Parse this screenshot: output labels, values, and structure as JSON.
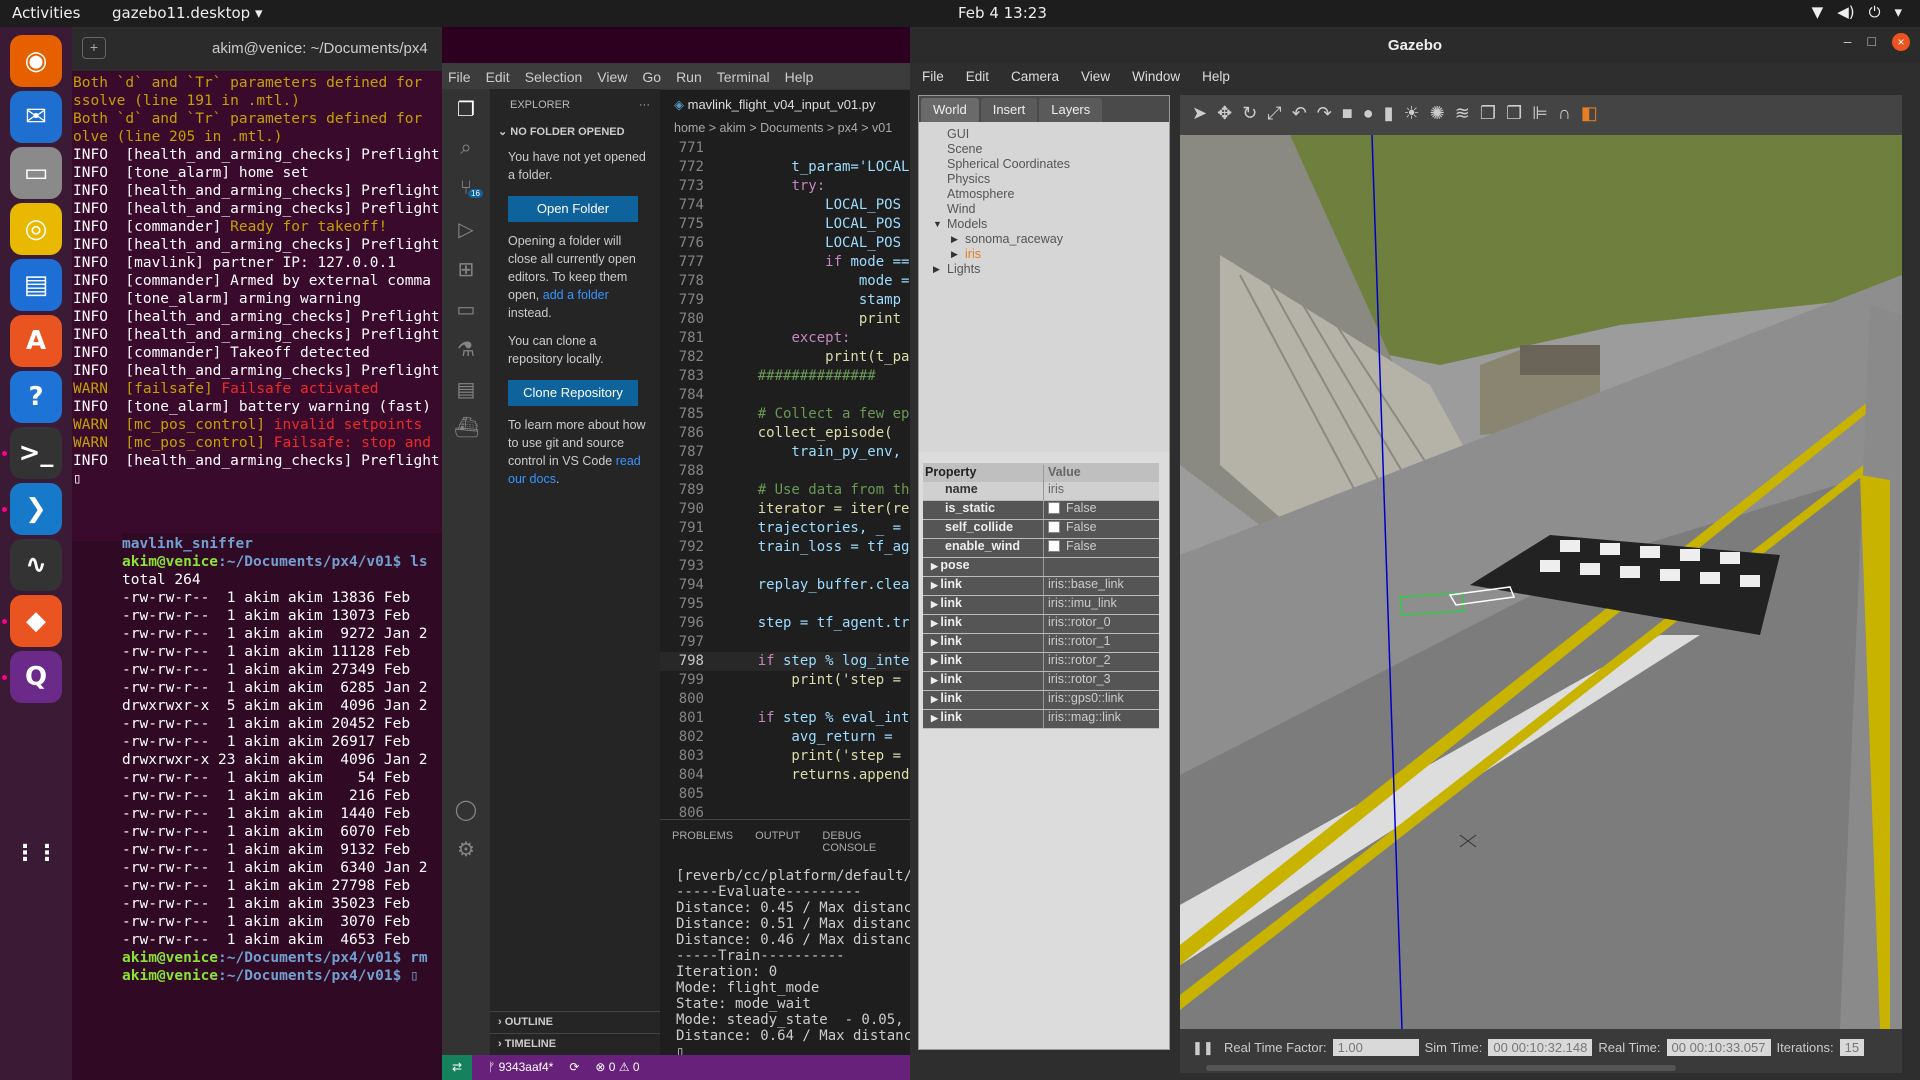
{
  "topbar": {
    "activities": "Activities",
    "app": "gazebo11.desktop ▾",
    "clock": "Feb 4  13:23",
    "tray": [
      "▼",
      "◀)",
      "⏻",
      "▾"
    ]
  },
  "dock": [
    {
      "icon": "firefox-icon",
      "glyph": "◉",
      "color": "#e66000"
    },
    {
      "icon": "thunderbird-icon",
      "glyph": "✉",
      "color": "#1f6fd0"
    },
    {
      "icon": "files-icon",
      "glyph": "▭",
      "color": "#8a8a8a"
    },
    {
      "icon": "rhythmbox-icon",
      "glyph": "◎",
      "color": "#e8b900"
    },
    {
      "icon": "writer-icon",
      "glyph": "▤",
      "color": "#1d6fd6"
    },
    {
      "icon": "software-icon",
      "glyph": "A",
      "color": "#e95420"
    },
    {
      "icon": "help-icon",
      "glyph": "?",
      "color": "#1d73d6"
    },
    {
      "icon": "terminal-icon",
      "glyph": ">_",
      "color": "#333"
    },
    {
      "icon": "vscode-icon",
      "glyph": "❯",
      "color": "#1679c9"
    },
    {
      "icon": "monitor-icon",
      "glyph": "∿",
      "color": "#333"
    },
    {
      "icon": "gazebo-icon",
      "glyph": "◆",
      "color": "#e95420"
    },
    {
      "icon": "qgroundcontrol-icon",
      "glyph": "Q",
      "color": "#6b2a8a"
    },
    {
      "icon": "apps-grid-icon",
      "glyph": "⋮⋮",
      "color": "transparent"
    }
  ],
  "terminal": {
    "title": "akim@venice: ~/Documents/px4",
    "pane1": [
      {
        "c": "y",
        "t": "Both `d` and `Tr` parameters defined for"
      },
      {
        "c": "y",
        "t": "ssolve (line 191 in .mtl.)"
      },
      {
        "c": "y",
        "t": "Both `d` and `Tr` parameters defined for"
      },
      {
        "c": "y",
        "t": "olve (line 205 in .mtl.)"
      },
      {
        "c": "",
        "t": ""
      },
      {
        "c": "",
        "t": "INFO  [health_and_arming_checks] Preflight"
      },
      {
        "c": "",
        "t": "INFO  [tone_alarm] home set"
      },
      {
        "c": "",
        "t": "INFO  [health_and_arming_checks] Preflight"
      },
      {
        "c": "",
        "t": "INFO  [health_and_arming_checks] Preflight"
      },
      {
        "c": "",
        "t": "INFO  [commander] ",
        "h": "Ready for takeoff!",
        "hc": "o"
      },
      {
        "c": "",
        "t": "INFO  [health_and_arming_checks] Preflight"
      },
      {
        "c": "",
        "t": "INFO  [mavlink] partner IP: 127.0.0.1"
      },
      {
        "c": "",
        "t": "INFO  [commander] Armed by external comma"
      },
      {
        "c": "",
        "t": "INFO  [tone_alarm] arming warning"
      },
      {
        "c": "",
        "t": "INFO  [health_and_arming_checks] Preflight"
      },
      {
        "c": "",
        "t": "INFO  [health_and_arming_checks] Preflight"
      },
      {
        "c": "",
        "t": "INFO  [commander] Takeoff detected"
      },
      {
        "c": "",
        "t": "INFO  [health_and_arming_checks] Preflight"
      },
      {
        "c": "y",
        "t": "WARN  [failsafe] ",
        "h": "Failsafe activated",
        "hc": "r"
      },
      {
        "c": "",
        "t": "INFO  [tone_alarm] battery warning (fast)"
      },
      {
        "c": "y",
        "t": "WARN  [mc_pos_control] ",
        "h": "invalid setpoints",
        "hc": "r"
      },
      {
        "c": "y",
        "t": "WARN  [mc_pos_control] ",
        "h": "Failsafe: stop and",
        "hc": "r"
      },
      {
        "c": "",
        "t": "INFO  [health_and_arming_checks] Preflight"
      },
      {
        "c": "",
        "t": "▯"
      }
    ],
    "pane2": [
      {
        "c": "b",
        "t": "mavlink_sniffer                      px"
      },
      {
        "c": "g",
        "t": "akim@venice",
        "p": ":~/Documents/px4/v01$ ls"
      },
      {
        "c": "",
        "t": "total 264"
      },
      {
        "c": "",
        "t": "-rw-rw-r--  1 akim akim 13836 Feb"
      },
      {
        "c": "",
        "t": "-rw-rw-r--  1 akim akim 13073 Feb"
      },
      {
        "c": "",
        "t": "-rw-rw-r--  1 akim akim  9272 Jan 2"
      },
      {
        "c": "",
        "t": "-rw-rw-r--  1 akim akim 11128 Feb"
      },
      {
        "c": "",
        "t": "-rw-rw-r--  1 akim akim 27349 Feb"
      },
      {
        "c": "",
        "t": "-rw-rw-r--  1 akim akim  6285 Jan 2"
      },
      {
        "c": "",
        "t": "drwxrwxr-x  5 akim akim  4096 Jan 2"
      },
      {
        "c": "",
        "t": "-rw-rw-r--  1 akim akim 20452 Feb"
      },
      {
        "c": "",
        "t": "-rw-rw-r--  1 akim akim 26917 Feb"
      },
      {
        "c": "",
        "t": "drwxrwxr-x 23 akim akim  4096 Jan 2"
      },
      {
        "c": "",
        "t": "-rw-rw-r--  1 akim akim    54 Feb"
      },
      {
        "c": "",
        "t": "-rw-rw-r--  1 akim akim   216 Feb"
      },
      {
        "c": "",
        "t": "-rw-rw-r--  1 akim akim  1440 Feb"
      },
      {
        "c": "",
        "t": "-rw-rw-r--  1 akim akim  6070 Feb"
      },
      {
        "c": "",
        "t": "-rw-rw-r--  1 akim akim  9132 Feb"
      },
      {
        "c": "",
        "t": "-rw-rw-r--  1 akim akim  6340 Jan 2"
      },
      {
        "c": "",
        "t": "-rw-rw-r--  1 akim akim 27798 Feb"
      },
      {
        "c": "",
        "t": "-rw-rw-r--  1 akim akim 35023 Feb"
      },
      {
        "c": "",
        "t": "-rw-rw-r--  1 akim akim  3070 Feb"
      },
      {
        "c": "",
        "t": "-rw-rw-r--  1 akim akim  4653 Feb"
      },
      {
        "c": "g",
        "t": "akim@venice",
        "p": ":~/Documents/px4/v01$ rm"
      },
      {
        "c": "g",
        "t": "akim@venice",
        "p": ":~/Documents/px4/v01$ ▯"
      }
    ]
  },
  "vscode": {
    "menu": [
      "File",
      "Edit",
      "Selection",
      "View",
      "Go",
      "Run",
      "Terminal",
      "Help"
    ],
    "explorer": {
      "title": "EXPLORER",
      "dots": "···",
      "no_folder": "NO FOLDER OPENED",
      "p1": "You have not yet opened a folder.",
      "open_btn": "Open Folder",
      "p2a": "Opening a folder will close all currently open editors. To keep them open, ",
      "p2link": "add a folder",
      "p2b": " instead.",
      "p3": "You can clone a repository locally.",
      "clone_btn": "Clone Repository",
      "p4a": "To learn more about how to use git and source control in VS Code ",
      "p4link": "read our docs",
      "p4b": ".",
      "outline": "OUTLINE",
      "timeline": "TIMELINE"
    },
    "scm_badge": "16",
    "tab": "mavlink_flight_v04_input_v01.py",
    "breadcrumb": "home > akim > Documents > px4 > v01",
    "code": [
      {
        "n": "771",
        "t": ""
      },
      {
        "n": "772",
        "t": "        t_param='LOCAL"
      },
      {
        "n": "773",
        "t": "        try:"
      },
      {
        "n": "774",
        "t": "            LOCAL_POS"
      },
      {
        "n": "775",
        "t": "            LOCAL_POS"
      },
      {
        "n": "776",
        "t": "            LOCAL_POS"
      },
      {
        "n": "777",
        "t": "            if mode =="
      },
      {
        "n": "778",
        "t": "                mode ="
      },
      {
        "n": "779",
        "t": "                stamp"
      },
      {
        "n": "780",
        "t": "                print"
      },
      {
        "n": "781",
        "t": "        except:"
      },
      {
        "n": "782",
        "t": "            print(t_pa"
      },
      {
        "n": "783",
        "t": "    ##############"
      },
      {
        "n": "784",
        "t": ""
      },
      {
        "n": "785",
        "t": "    # Collect a few ep"
      },
      {
        "n": "786",
        "t": "    collect_episode("
      },
      {
        "n": "787",
        "t": "        train_py_env,"
      },
      {
        "n": "788",
        "t": ""
      },
      {
        "n": "789",
        "t": "    # Use data from th"
      },
      {
        "n": "790",
        "t": "    iterator = iter(re"
      },
      {
        "n": "791",
        "t": "    trajectories, _ ="
      },
      {
        "n": "792",
        "t": "    train_loss = tf_ag"
      },
      {
        "n": "793",
        "t": ""
      },
      {
        "n": "794",
        "t": "    replay_buffer.clea"
      },
      {
        "n": "795",
        "t": ""
      },
      {
        "n": "796",
        "t": "    step = tf_agent.tr"
      },
      {
        "n": "797",
        "t": ""
      },
      {
        "n": "798",
        "t": "    if step % log_inte"
      },
      {
        "n": "799",
        "t": "        print('step ="
      },
      {
        "n": "800",
        "t": ""
      },
      {
        "n": "801",
        "t": "    if step % eval_int"
      },
      {
        "n": "802",
        "t": "        avg_return ="
      },
      {
        "n": "803",
        "t": "        print('step ="
      },
      {
        "n": "804",
        "t": "        returns.append"
      },
      {
        "n": "805",
        "t": ""
      },
      {
        "n": "806",
        "t": ""
      }
    ],
    "panel_tabs": [
      "PROBLEMS",
      "OUTPUT",
      "DEBUG CONSOLE"
    ],
    "panel_out": [
      "[reverb/cc/platform/default/s",
      "-----Evaluate---------",
      "Distance: 0.45 / Max distance",
      "Distance: 0.51 / Max distance",
      "Distance: 0.46 / Max distance",
      "-----Train----------",
      "Iteration: 0",
      "Mode: flight_mode",
      "State: mode_wait",
      "Mode: steady_state  - 0.05, 0",
      "Distance: 0.64 / Max distance",
      "▯"
    ],
    "status": {
      "remote": "⇄",
      "branch": "ᚠ 9343aaf4*",
      "sync": "⟳",
      "problems": "⊗ 0 ⚠ 0"
    }
  },
  "gazebo": {
    "title": "Gazebo",
    "menu": [
      "File",
      "Edit",
      "Camera",
      "View",
      "Window",
      "Help"
    ],
    "tabs": [
      "World",
      "Insert",
      "Layers"
    ],
    "tree": [
      {
        "t": "GUI",
        "i": 0
      },
      {
        "t": "Scene",
        "i": 0
      },
      {
        "t": "Spherical Coordinates",
        "i": 0
      },
      {
        "t": "Physics",
        "i": 0
      },
      {
        "t": "Atmosphere",
        "i": 0
      },
      {
        "t": "Wind",
        "i": 0
      },
      {
        "t": "Models",
        "i": 0,
        "arrow": "▼"
      },
      {
        "t": "sonoma_raceway",
        "i": 1,
        "arrow": "▶"
      },
      {
        "t": "iris",
        "i": 1,
        "arrow": "▶",
        "sel": true
      },
      {
        "t": "Lights",
        "i": 0,
        "arrow": "▶"
      }
    ],
    "props_header": [
      "Property",
      "Value"
    ],
    "props": [
      {
        "k": "name",
        "v": "iris",
        "dark": false
      },
      {
        "k": "is_static",
        "v": "False",
        "chk": true,
        "dark": true
      },
      {
        "k": "self_collide",
        "v": "False",
        "chk": true,
        "dark": true
      },
      {
        "k": "enable_wind",
        "v": "False",
        "chk": true,
        "dark": true
      },
      {
        "k": "pose",
        "v": "",
        "arrow": true,
        "dark": true
      },
      {
        "k": "link",
        "v": "iris::base_link",
        "arrow": true,
        "dark": true
      },
      {
        "k": "link",
        "v": "iris::imu_link",
        "arrow": true,
        "dark": true
      },
      {
        "k": "link",
        "v": "iris::rotor_0",
        "arrow": true,
        "dark": true
      },
      {
        "k": "link",
        "v": "iris::rotor_1",
        "arrow": true,
        "dark": true
      },
      {
        "k": "link",
        "v": "iris::rotor_2",
        "arrow": true,
        "dark": true
      },
      {
        "k": "link",
        "v": "iris::rotor_3",
        "arrow": true,
        "dark": true
      },
      {
        "k": "link",
        "v": "iris::gps0::link",
        "arrow": true,
        "dark": true
      },
      {
        "k": "link",
        "v": "iris::mag::link",
        "arrow": true,
        "dark": true
      }
    ],
    "toolbar": [
      "➤",
      "✥",
      "↻",
      "⤢",
      "↶",
      "↷",
      "■",
      "●",
      "▮",
      "☀",
      "✺",
      "≋",
      "❐",
      "❐",
      "⊫",
      "∩",
      "◧"
    ],
    "bottom": {
      "pause": "❚❚",
      "rtf_label": "Real Time Factor:",
      "rtf": "1.00",
      "sim_label": "Sim Time:",
      "sim": "00 00:10:32.148",
      "real_label": "Real Time:",
      "real": "00 00:10:33.057",
      "iter_label": "Iterations:",
      "iter": "15"
    }
  }
}
